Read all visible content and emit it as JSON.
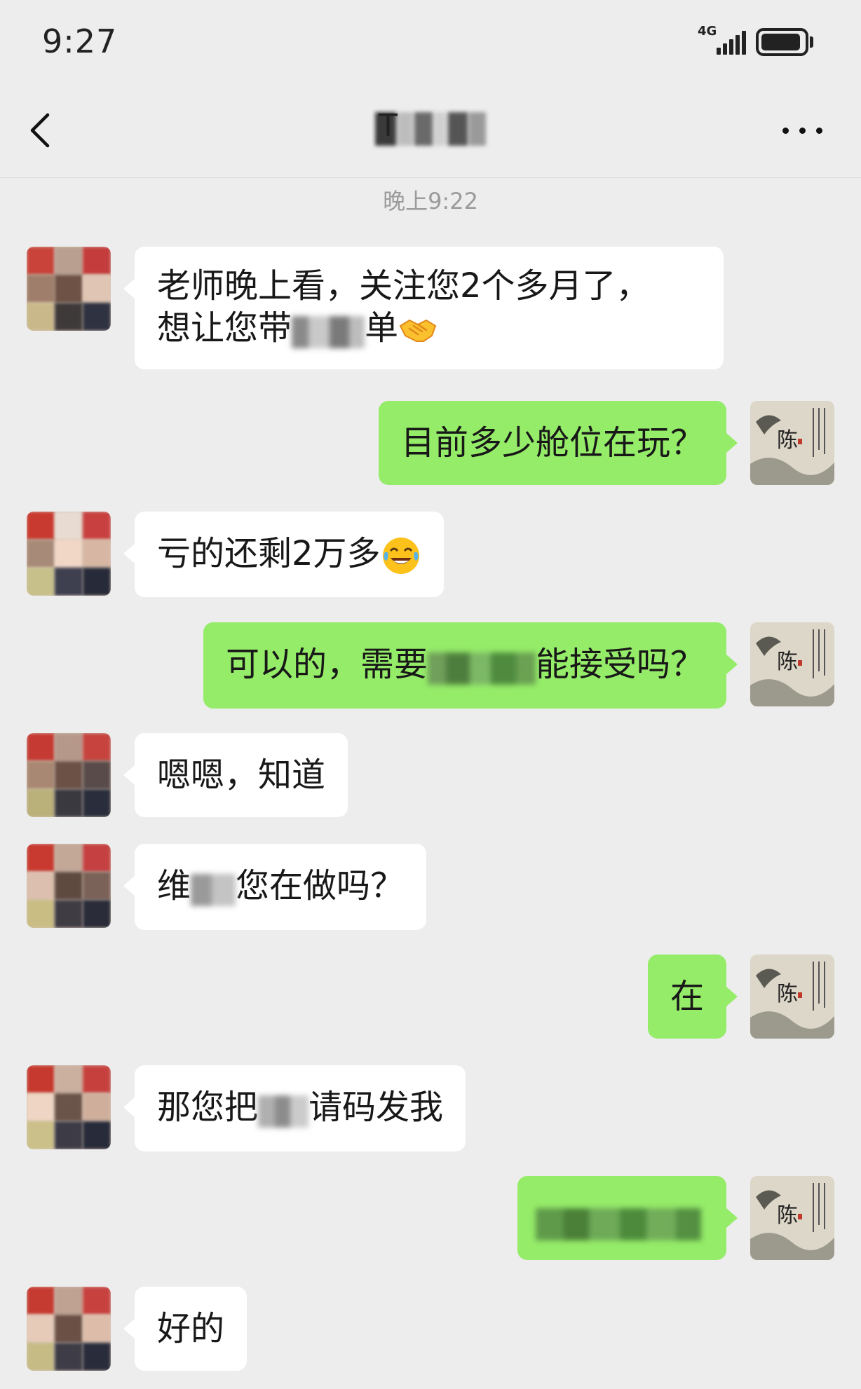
{
  "status_bar": {
    "time": "9:27",
    "network": "4G",
    "signal_icon": "signal-bars-icon",
    "battery_icon": "battery-icon"
  },
  "nav": {
    "back_icon": "chevron-left-icon",
    "title": "T",
    "more_icon": "more-dots-icon"
  },
  "timestamp": "晚上9:22",
  "colors": {
    "background": "#ededed",
    "bubble_incoming": "#ffffff",
    "bubble_outgoing": "#95ec69",
    "timestamp_text": "#9b9b9b"
  },
  "messages": [
    {
      "from": "other",
      "line1": "老师晚上看，关注您2个多月了，",
      "line2_a": "想让您带",
      "line2_b": "单",
      "emoji": "handshake-emoji"
    },
    {
      "from": "me",
      "text": "目前多少舱位在玩？"
    },
    {
      "from": "other",
      "text": "亏的还剩2万多",
      "emoji": "tears-of-joy-emoji"
    },
    {
      "from": "me",
      "text_a": "可以的，需要",
      "text_b": "能接受吗？"
    },
    {
      "from": "other",
      "text": "嗯嗯，知道"
    },
    {
      "from": "other",
      "text_a": "维",
      "text_b": "您在做吗？"
    },
    {
      "from": "me",
      "text": "在"
    },
    {
      "from": "other",
      "text_a": "那您把",
      "text_b": "请码发我"
    },
    {
      "from": "me",
      "text": ""
    },
    {
      "from": "other",
      "text": "好的"
    }
  ]
}
